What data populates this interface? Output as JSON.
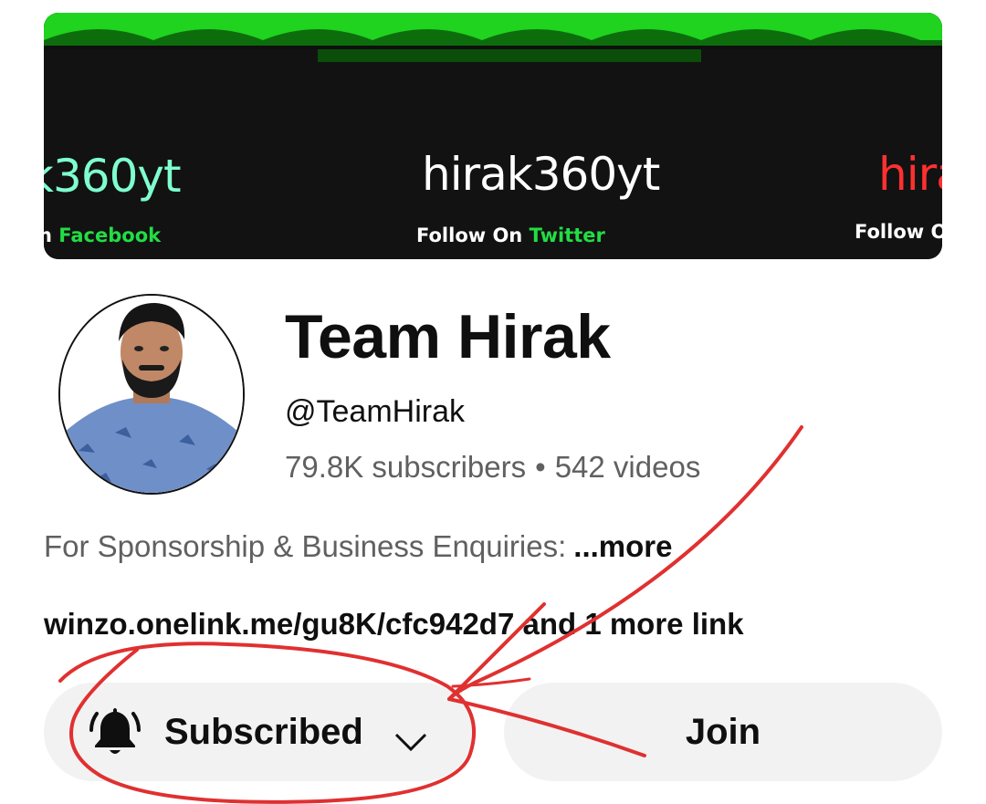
{
  "banner": {
    "handles": [
      "k360yt",
      "hirak360yt",
      "hira"
    ],
    "follow": [
      {
        "prefix": "n ",
        "network": "Facebook"
      },
      {
        "prefix": "Follow On ",
        "network": "Twitter"
      },
      {
        "prefix": "Follow O",
        "network": ""
      }
    ]
  },
  "channel": {
    "name": "Team Hirak",
    "handle": "@TeamHirak",
    "subscribers": "79.8K subscribers",
    "separator": "•",
    "videos": "542 videos"
  },
  "description": {
    "text": "For Sponsorship & Business Enquiries:",
    "more_label": "...more"
  },
  "links": {
    "url": "winzo.onelink.me/gu8K/cfc942d7",
    "suffix": "and 1 more link"
  },
  "actions": {
    "subscribed_label": "Subscribed",
    "join_label": "Join"
  },
  "colors": {
    "banner_green": "#22dd22",
    "annotation_red": "#e03030",
    "button_bg": "#f2f2f2",
    "secondary_text": "#606060"
  },
  "icons": [
    "bell-icon",
    "chevron-down-icon"
  ]
}
